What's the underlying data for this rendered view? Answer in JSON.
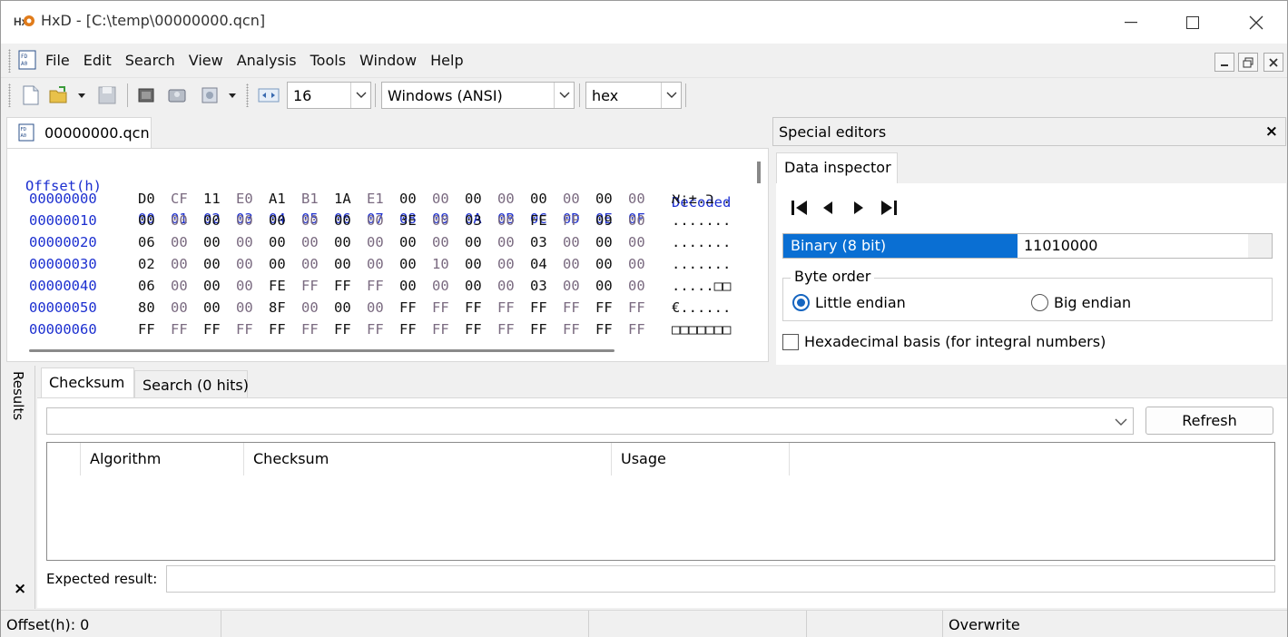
{
  "window": {
    "title": "HxD - [C:\\temp\\00000000.qcn]"
  },
  "menu": {
    "items": [
      "File",
      "Edit",
      "Search",
      "View",
      "Analysis",
      "Tools",
      "Window",
      "Help"
    ]
  },
  "toolbar": {
    "bytes_per_row": "16",
    "charset": "Windows (ANSI)",
    "offset_base": "hex"
  },
  "document_tab": {
    "label": "00000000.qcn"
  },
  "hex": {
    "offset_header": "Offset(h)",
    "column_headers": [
      "00",
      "01",
      "02",
      "03",
      "04",
      "05",
      "06",
      "07",
      "08",
      "09",
      "0A",
      "0B",
      "0C",
      "0D",
      "0E",
      "0F"
    ],
    "decoded_header": "Decoded",
    "rows": [
      {
        "offset": "00000000",
        "bytes": [
          "D0",
          "CF",
          "11",
          "E0",
          "A1",
          "B1",
          "1A",
          "E1",
          "00",
          "00",
          "00",
          "00",
          "00",
          "00",
          "00",
          "00"
        ],
        "decoded": "ב.±¡א ."
      },
      {
        "offset": "00000010",
        "bytes": [
          "00",
          "00",
          "00",
          "00",
          "00",
          "00",
          "00",
          "00",
          "3E",
          "00",
          "03",
          "00",
          "FE",
          "FF",
          "09",
          "00"
        ],
        "decoded": "......."
      },
      {
        "offset": "00000020",
        "bytes": [
          "06",
          "00",
          "00",
          "00",
          "00",
          "00",
          "00",
          "00",
          "00",
          "00",
          "00",
          "00",
          "03",
          "00",
          "00",
          "00"
        ],
        "decoded": "......."
      },
      {
        "offset": "00000030",
        "bytes": [
          "02",
          "00",
          "00",
          "00",
          "00",
          "00",
          "00",
          "00",
          "00",
          "10",
          "00",
          "00",
          "04",
          "00",
          "00",
          "00"
        ],
        "decoded": "......."
      },
      {
        "offset": "00000040",
        "bytes": [
          "06",
          "00",
          "00",
          "00",
          "FE",
          "FF",
          "FF",
          "FF",
          "00",
          "00",
          "00",
          "00",
          "03",
          "00",
          "00",
          "00"
        ],
        "decoded": ".....□□"
      },
      {
        "offset": "00000050",
        "bytes": [
          "80",
          "00",
          "00",
          "00",
          "8F",
          "00",
          "00",
          "00",
          "FF",
          "FF",
          "FF",
          "FF",
          "FF",
          "FF",
          "FF",
          "FF"
        ],
        "decoded": "€......"
      },
      {
        "offset": "00000060",
        "bytes": [
          "FF",
          "FF",
          "FF",
          "FF",
          "FF",
          "FF",
          "FF",
          "FF",
          "FF",
          "FF",
          "FF",
          "FF",
          "FF",
          "FF",
          "FF",
          "FF"
        ],
        "decoded": "□□□□□□□"
      }
    ]
  },
  "special_editors": {
    "title": "Special editors",
    "close": "×",
    "tab": "Data inspector",
    "inspector": {
      "type": "Binary (8 bit)",
      "value": "11010000"
    },
    "byte_order": {
      "legend": "Byte order",
      "little": "Little endian",
      "big": "Big endian",
      "selected": "little"
    },
    "hex_basis": "Hexadecimal basis (for integral numbers)"
  },
  "results": {
    "side_label": "Results",
    "close": "×",
    "tabs": [
      "Checksum",
      "Search (0 hits)"
    ],
    "refresh": "Refresh",
    "columns": [
      "Algorithm",
      "Checksum",
      "Usage"
    ],
    "expected_label": "Expected result:"
  },
  "status": {
    "offset": "Offset(h): 0",
    "mode": "Overwrite"
  },
  "colors": {
    "accent": "#0a6fd3",
    "offset_blue": "#1c2fd0"
  }
}
